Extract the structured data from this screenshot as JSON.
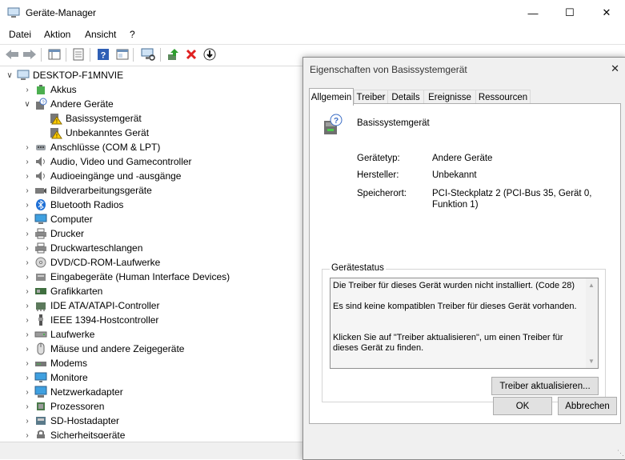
{
  "window": {
    "title": "Geräte-Manager",
    "minimize": "—",
    "maximize": "☐",
    "close": "✕"
  },
  "menu": [
    "Datei",
    "Aktion",
    "Ansicht",
    "?"
  ],
  "tree": {
    "root": "DESKTOP-F1MNVIE",
    "items": [
      {
        "label": "Akkus",
        "level": 1,
        "expanded": false,
        "icon": "battery-icon"
      },
      {
        "label": "Andere Geräte",
        "level": 1,
        "expanded": true,
        "icon": "unknown-device-icon"
      },
      {
        "label": "Basissystemgerät",
        "level": 2,
        "expanded": null,
        "icon": "warning-device-icon"
      },
      {
        "label": "Unbekanntes Gerät",
        "level": 2,
        "expanded": null,
        "icon": "warning-device-icon"
      },
      {
        "label": "Anschlüsse (COM & LPT)",
        "level": 1,
        "expanded": false,
        "icon": "port-icon"
      },
      {
        "label": "Audio, Video und Gamecontroller",
        "level": 1,
        "expanded": false,
        "icon": "speaker-icon"
      },
      {
        "label": "Audioeingänge und -ausgänge",
        "level": 1,
        "expanded": false,
        "icon": "speaker-icon"
      },
      {
        "label": "Bildverarbeitungsgeräte",
        "level": 1,
        "expanded": false,
        "icon": "camera-icon"
      },
      {
        "label": "Bluetooth Radios",
        "level": 1,
        "expanded": false,
        "icon": "bluetooth-icon"
      },
      {
        "label": "Computer",
        "level": 1,
        "expanded": false,
        "icon": "computer-icon"
      },
      {
        "label": "Drucker",
        "level": 1,
        "expanded": false,
        "icon": "printer-icon"
      },
      {
        "label": "Druckwarteschlangen",
        "level": 1,
        "expanded": false,
        "icon": "printer-icon"
      },
      {
        "label": "DVD/CD-ROM-Laufwerke",
        "level": 1,
        "expanded": false,
        "icon": "disc-icon"
      },
      {
        "label": "Eingabegeräte (Human Interface Devices)",
        "level": 1,
        "expanded": false,
        "icon": "hid-icon"
      },
      {
        "label": "Grafikkarten",
        "level": 1,
        "expanded": false,
        "icon": "display-adapter-icon"
      },
      {
        "label": "IDE ATA/ATAPI-Controller",
        "level": 1,
        "expanded": false,
        "icon": "controller-icon"
      },
      {
        "label": "IEEE 1394-Hostcontroller",
        "level": 1,
        "expanded": false,
        "icon": "firewire-icon"
      },
      {
        "label": "Laufwerke",
        "level": 1,
        "expanded": false,
        "icon": "drive-icon"
      },
      {
        "label": "Mäuse und andere Zeigegeräte",
        "level": 1,
        "expanded": false,
        "icon": "mouse-icon"
      },
      {
        "label": "Modems",
        "level": 1,
        "expanded": false,
        "icon": "modem-icon"
      },
      {
        "label": "Monitore",
        "level": 1,
        "expanded": false,
        "icon": "monitor-icon"
      },
      {
        "label": "Netzwerkadapter",
        "level": 1,
        "expanded": false,
        "icon": "network-icon"
      },
      {
        "label": "Prozessoren",
        "level": 1,
        "expanded": false,
        "icon": "cpu-icon"
      },
      {
        "label": "SD-Hostadapter",
        "level": 1,
        "expanded": false,
        "icon": "sd-icon"
      },
      {
        "label": "Sicherheitsgeräte",
        "level": 1,
        "expanded": false,
        "icon": "security-icon"
      }
    ]
  },
  "dialog": {
    "title": "Eigenschaften von Basissystemgerät",
    "close": "✕",
    "tabs": [
      "Allgemein",
      "Treiber",
      "Details",
      "Ereignisse",
      "Ressourcen"
    ],
    "active_tab": "Allgemein",
    "device_name": "Basissystemgerät",
    "props": {
      "type_label": "Gerätetyp:",
      "type_value": "Andere Geräte",
      "vendor_label": "Hersteller:",
      "vendor_value": "Unbekannt",
      "location_label": "Speicherort:",
      "location_value_1": "PCI-Steckplatz 2 (PCI-Bus 35, Gerät 0,",
      "location_value_2": "Funktion 1)"
    },
    "status": {
      "group_title": "Gerätestatus",
      "line1": "Die Treiber für dieses Gerät wurden nicht installiert. (Code 28)",
      "line2": "Es sind keine kompatiblen Treiber für dieses Gerät vorhanden.",
      "line3": "Klicken Sie auf \"Treiber aktualisieren\", um einen Treiber für dieses Gerät zu finden."
    },
    "update_button": "Treiber aktualisieren...",
    "ok_button": "OK",
    "cancel_button": "Abbrechen"
  }
}
